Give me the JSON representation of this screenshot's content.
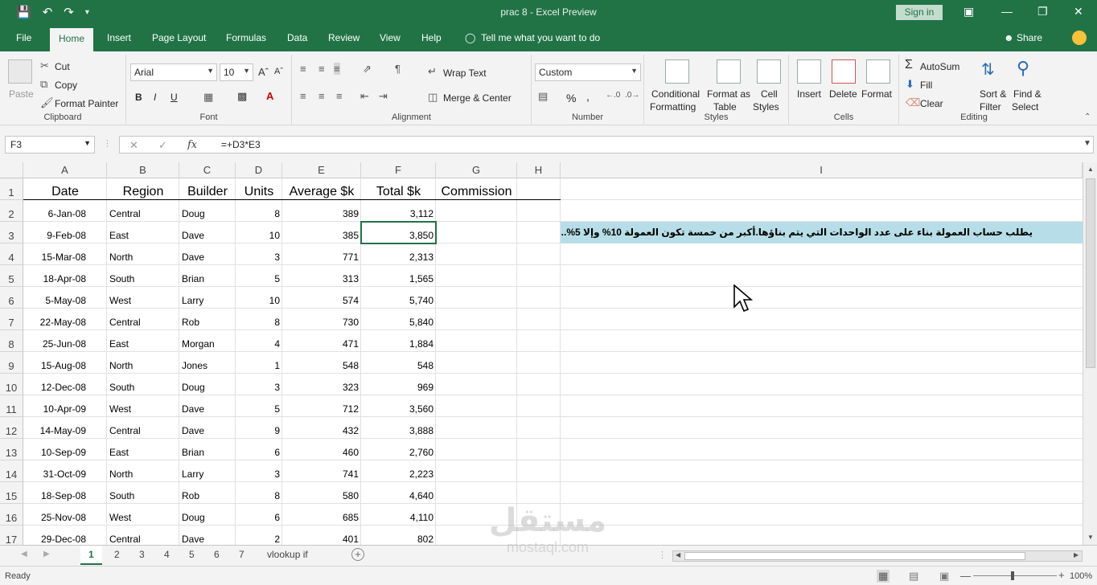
{
  "window": {
    "title": "prac 8  -  Excel Preview",
    "signin": "Sign in"
  },
  "tabs": {
    "items": [
      "File",
      "Home",
      "Insert",
      "Page Layout",
      "Formulas",
      "Data",
      "Review",
      "View",
      "Help"
    ],
    "tell": "Tell me what you want to do",
    "share": "Share"
  },
  "ribbon": {
    "clipboard": {
      "paste": "Paste",
      "cut": "Cut",
      "copy": "Copy",
      "format_painter": "Format Painter",
      "label": "Clipboard"
    },
    "font": {
      "name": "Arial",
      "size": "10",
      "bold": "B",
      "italic": "I",
      "underline": "U",
      "label": "Font"
    },
    "alignment": {
      "wrap": "Wrap Text",
      "merge": "Merge & Center",
      "label": "Alignment"
    },
    "number": {
      "format": "Custom",
      "percent": "%",
      "comma": ",",
      "label": "Number"
    },
    "styles": {
      "conditional": "Conditional",
      "conditional2": "Formatting",
      "format_as": "Format as",
      "format_as2": "Table",
      "cell": "Cell",
      "cell2": "Styles",
      "label": "Styles"
    },
    "cells": {
      "insert": "Insert",
      "delete": "Delete",
      "format": "Format",
      "label": "Cells"
    },
    "editing": {
      "autosum": "AutoSum",
      "fill": "Fill",
      "clear": "Clear",
      "sort": "Sort &",
      "sort2": "Filter",
      "find": "Find &",
      "find2": "Select",
      "label": "Editing"
    }
  },
  "formula": {
    "namebox": "F3",
    "fx": "fx",
    "text": "=+D3*E3"
  },
  "sheet": {
    "columns": [
      "A",
      "B",
      "C",
      "D",
      "E",
      "F",
      "G",
      "H",
      "I"
    ],
    "headers": [
      "Date",
      "Region",
      "Builder",
      "Units",
      "Average $k",
      "Total $k",
      "Commission"
    ],
    "rows": [
      [
        "6-Jan-08",
        "Central",
        "Doug",
        "8",
        "389",
        "3,112"
      ],
      [
        "9-Feb-08",
        "East",
        "Dave",
        "10",
        "385",
        "3,850"
      ],
      [
        "15-Mar-08",
        "North",
        "Dave",
        "3",
        "771",
        "2,313"
      ],
      [
        "18-Apr-08",
        "South",
        "Brian",
        "5",
        "313",
        "1,565"
      ],
      [
        "5-May-08",
        "West",
        "Larry",
        "10",
        "574",
        "5,740"
      ],
      [
        "22-May-08",
        "Central",
        "Rob",
        "8",
        "730",
        "5,840"
      ],
      [
        "25-Jun-08",
        "East",
        "Morgan",
        "4",
        "471",
        "1,884"
      ],
      [
        "15-Aug-08",
        "North",
        "Jones",
        "1",
        "548",
        "548"
      ],
      [
        "12-Dec-08",
        "South",
        "Doug",
        "3",
        "323",
        "969"
      ],
      [
        "10-Apr-09",
        "West",
        "Dave",
        "5",
        "712",
        "3,560"
      ],
      [
        "14-May-09",
        "Central",
        "Dave",
        "9",
        "432",
        "3,888"
      ],
      [
        "10-Sep-09",
        "East",
        "Brian",
        "6",
        "460",
        "2,760"
      ],
      [
        "31-Oct-09",
        "North",
        "Larry",
        "3",
        "741",
        "2,223"
      ],
      [
        "18-Sep-08",
        "South",
        "Rob",
        "8",
        "580",
        "4,640"
      ],
      [
        "25-Nov-08",
        "West",
        "Doug",
        "6",
        "685",
        "4,110"
      ],
      [
        "29-Dec-08",
        "Central",
        "Dave",
        "2",
        "401",
        "802"
      ]
    ],
    "note": "يطلب حساب العمولة بناء على عدد الواحدات التي يتم بناؤها.أكبر من خمسة تكون العمولة 10%  وإلا 5%...."
  },
  "sheet_tabs": [
    "1",
    "2",
    "3",
    "4",
    "5",
    "6",
    "7",
    "vlookup if"
  ],
  "status": {
    "ready": "Ready",
    "zoom": "100%"
  },
  "watermark": {
    "big": "مستقل",
    "small": "mostaql.com"
  },
  "colors": {
    "accent": "#217346",
    "note_bg": "#b7dee8"
  }
}
